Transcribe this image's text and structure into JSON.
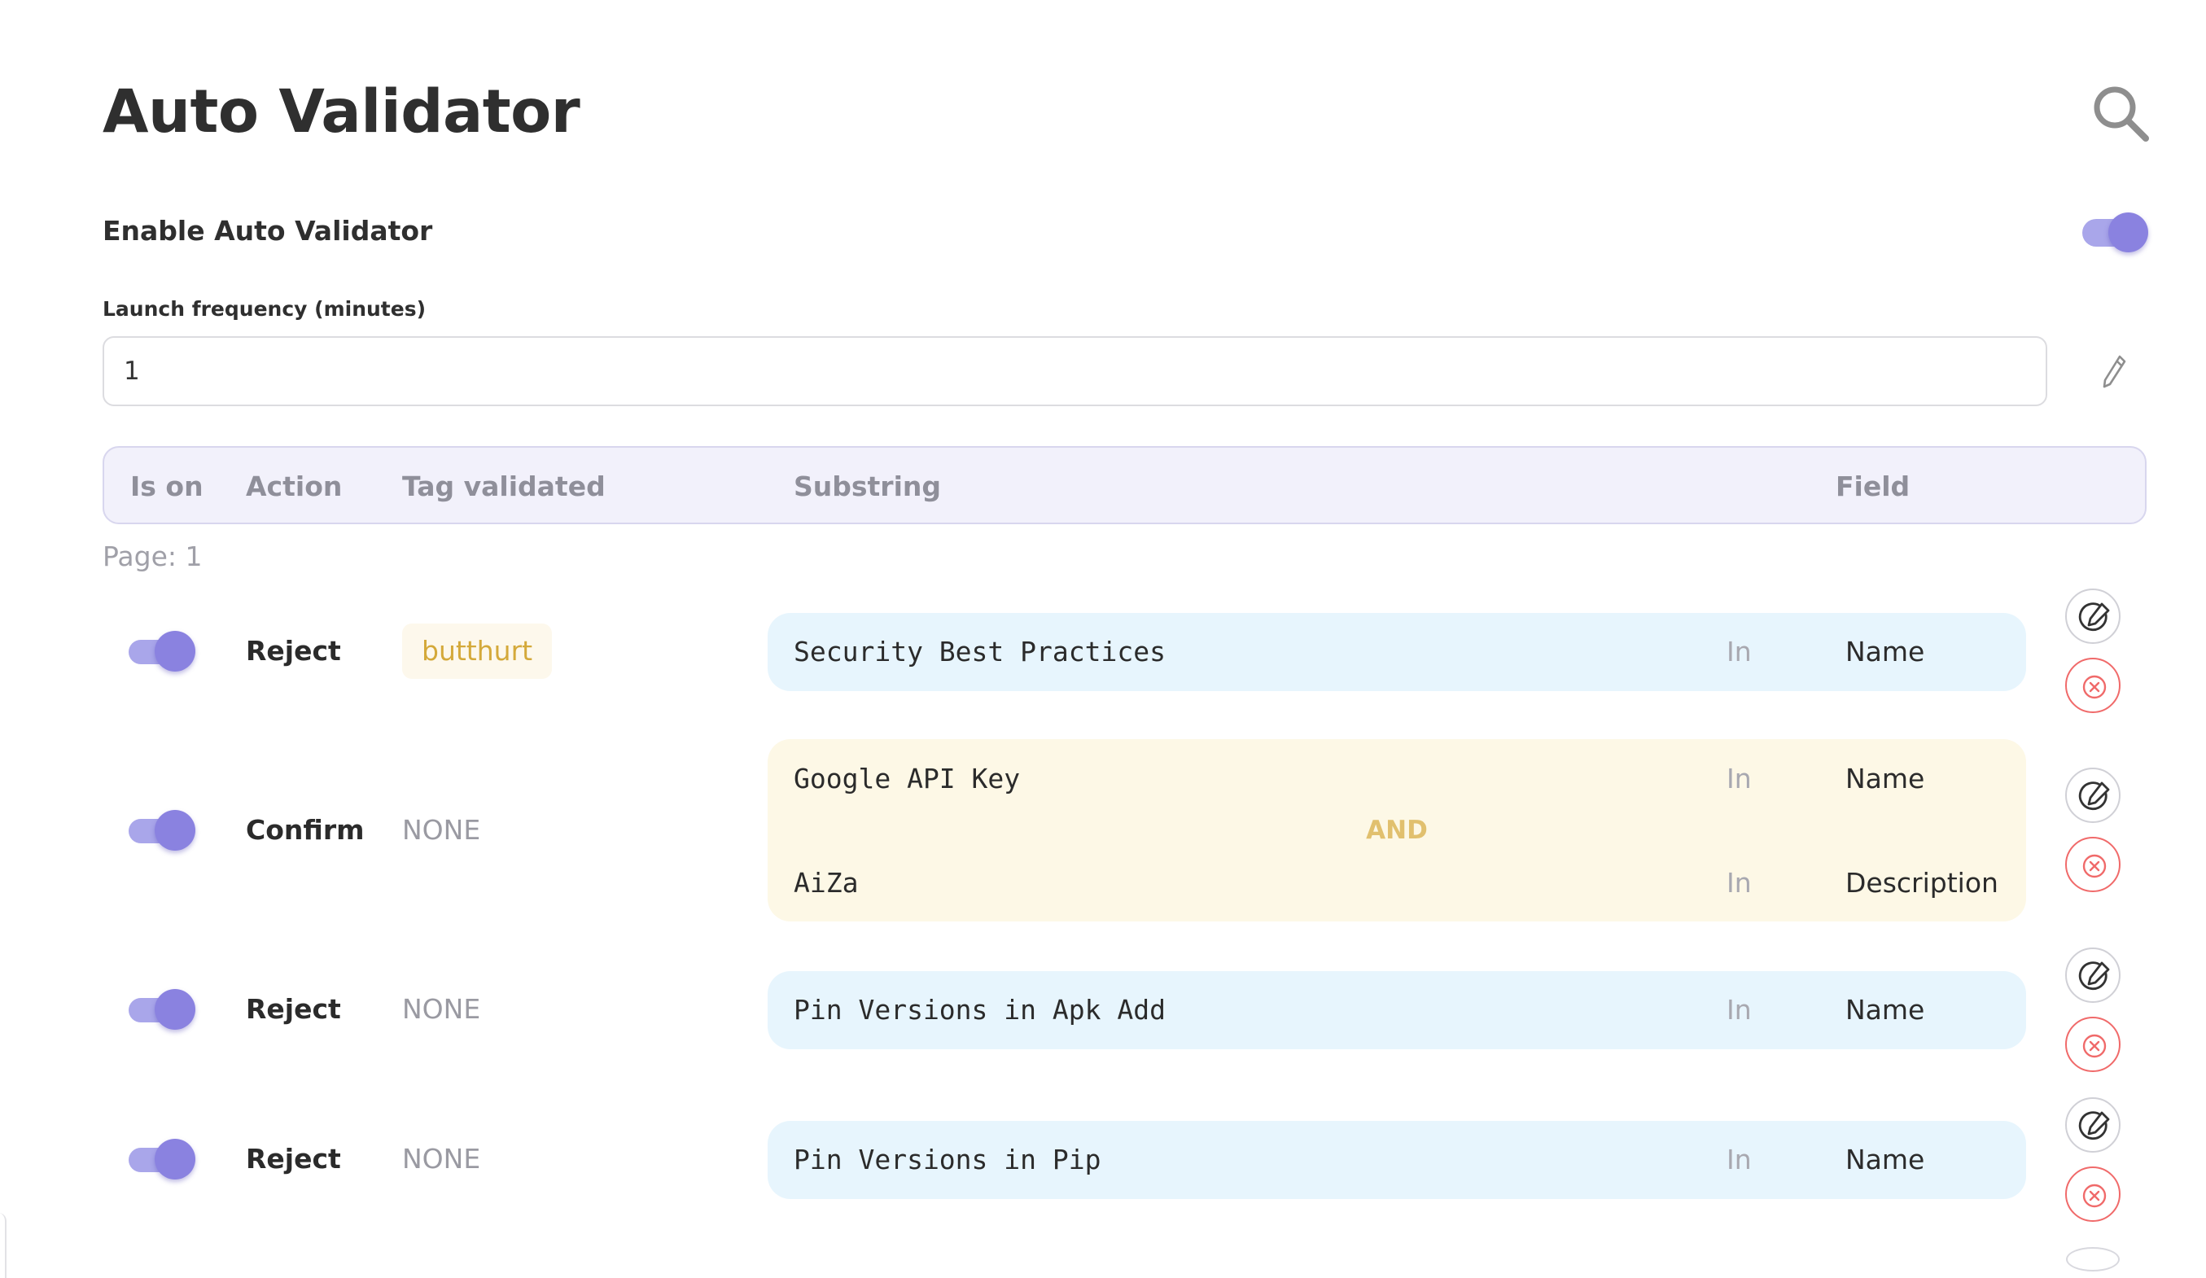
{
  "header": {
    "title": "Auto Validator"
  },
  "settings": {
    "enable_label": "Enable Auto Validator",
    "enabled": true,
    "frequency_label": "Launch frequency (minutes)",
    "frequency_value": "1"
  },
  "table": {
    "columns": {
      "is_on": "Is on",
      "action": "Action",
      "tag": "Tag validated",
      "substring": "Substring",
      "field": "Field"
    },
    "page_label": "Page: 1",
    "rows": [
      {
        "is_on": true,
        "action": "Reject",
        "tag": "butthurt",
        "conditions": [
          {
            "substring": "Security Best Practices",
            "in": "In",
            "field": "Name"
          }
        ]
      },
      {
        "is_on": true,
        "action": "Confirm",
        "tag": "NONE",
        "operator": "AND",
        "conditions": [
          {
            "substring": "Google API Key",
            "in": "In",
            "field": "Name"
          },
          {
            "substring": "AiZa",
            "in": "In",
            "field": "Description"
          }
        ]
      },
      {
        "is_on": true,
        "action": "Reject",
        "tag": "NONE",
        "conditions": [
          {
            "substring": "Pin Versions in Apk Add",
            "in": "In",
            "field": "Name"
          }
        ]
      },
      {
        "is_on": true,
        "action": "Reject",
        "tag": "NONE",
        "conditions": [
          {
            "substring": "Pin Versions in Pip",
            "in": "In",
            "field": "Name"
          }
        ]
      }
    ]
  },
  "icons": {
    "search": "search-icon",
    "edit_field": "pencil-icon",
    "row_edit": "edit-icon",
    "row_delete": "delete-icon"
  },
  "colors": {
    "accent": "#8a82e0",
    "accent_light": "#a9a6ea",
    "single_condition_bg": "#e7f5fd",
    "multi_condition_bg": "#fdf8e6",
    "operator_text": "#e1c06e",
    "tag_text": "#d4a93a",
    "delete": "#f06a6a"
  }
}
